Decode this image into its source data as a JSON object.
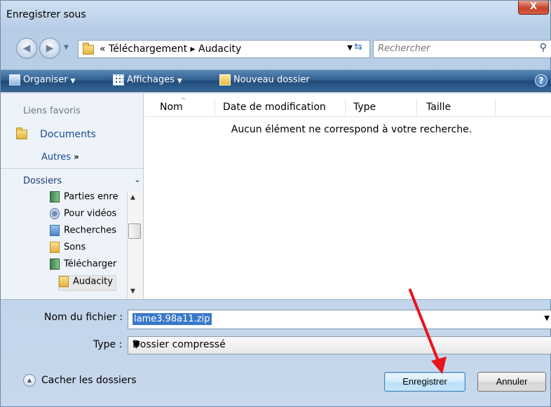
{
  "window": {
    "title": "Enregistrer sous",
    "close_label": "X"
  },
  "address": {
    "crumbs": "« Téléchargement ▸ Audacity",
    "search_placeholder": "Rechercher"
  },
  "toolbar": {
    "organiser": "Organiser",
    "affichages": "Affichages",
    "nouveau_dossier": "Nouveau dossier",
    "help": "?"
  },
  "navpane": {
    "favorites_title": "Liens favoris",
    "favorites": [
      {
        "label": "Documents",
        "icon": "folder-icon"
      }
    ],
    "more": "Autres",
    "more_suffix": "»",
    "folders_title": "Dossiers",
    "tree": [
      {
        "label": "Parties enre",
        "icon": "green-folder-icon"
      },
      {
        "label": "Pour vidéos",
        "icon": "video-icon"
      },
      {
        "label": "Recherches",
        "icon": "search-folder-icon"
      },
      {
        "label": "Sons",
        "icon": "folder-icon"
      },
      {
        "label": "Télécharger",
        "icon": "green-folder-icon"
      },
      {
        "label": "Audacity",
        "icon": "folder-icon",
        "selected": true
      }
    ]
  },
  "list": {
    "columns": [
      "Nom",
      "Date de modification",
      "Type",
      "Taille"
    ],
    "empty_message": "Aucun élément ne correspond à votre recherche."
  },
  "form": {
    "filename_label": "Nom du fichier :",
    "filename_value": "lame3.98a11.zip",
    "type_label": "Type :",
    "type_value": "Dossier compressé"
  },
  "footer": {
    "hide_folders": "Cacher les dossiers",
    "save": "Enregistrer",
    "cancel": "Annuler"
  },
  "colors": {
    "toolbar": "#2d5b8b",
    "selection": "#3a79c9",
    "link": "#1a4b91",
    "annotation_arrow": "#e8141b"
  }
}
